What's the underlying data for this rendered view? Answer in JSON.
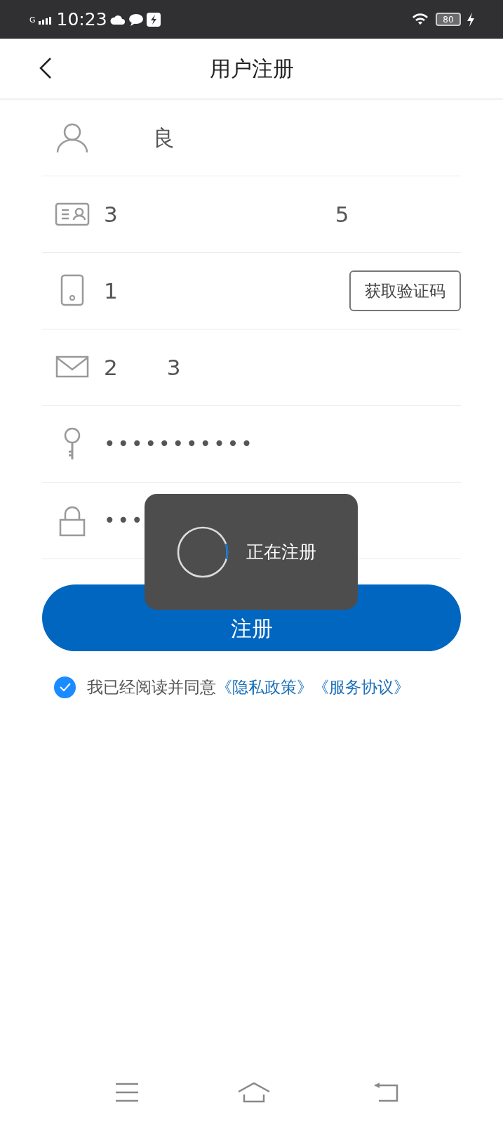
{
  "status_bar": {
    "network": "G",
    "time": "10:23",
    "battery": "80",
    "charging": true
  },
  "header": {
    "title": "用户注册"
  },
  "fields": [
    {
      "kind": "text",
      "value_end": "良"
    },
    {
      "kind": "text",
      "value_start": "3",
      "value_end": "5"
    },
    {
      "kind": "text",
      "value_start": "1",
      "button": "获取验证码"
    },
    {
      "kind": "text",
      "value_start": "2",
      "value_end": "3"
    },
    {
      "kind": "password",
      "value": "•••••••••••"
    },
    {
      "kind": "password",
      "value": "•••"
    }
  ],
  "submit": {
    "label": "注册"
  },
  "agreement": {
    "checked": true,
    "text": "我已经阅读并同意",
    "links": [
      "《隐私政策》",
      "《服务协议》"
    ]
  },
  "toast": {
    "text": "正在注册",
    "level": 0.1
  }
}
